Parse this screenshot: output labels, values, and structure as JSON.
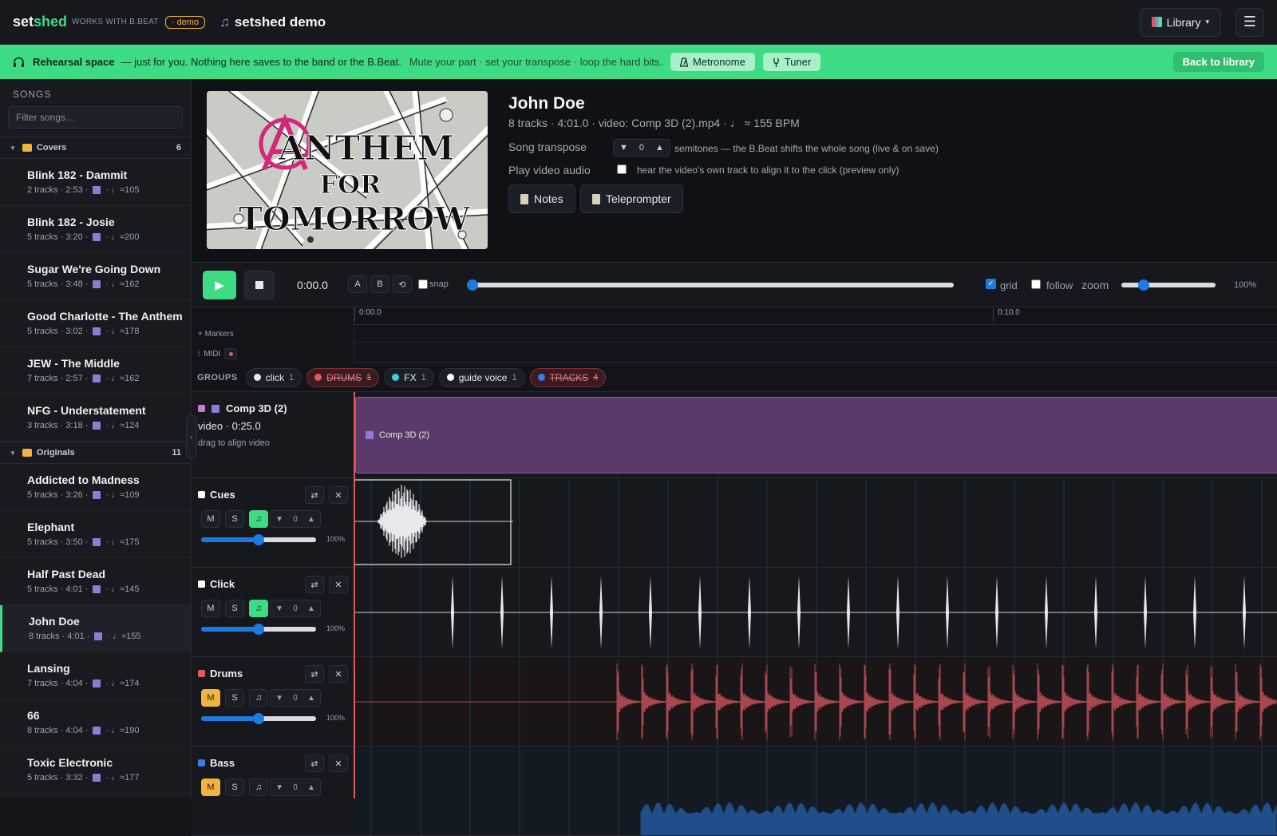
{
  "topbar": {
    "logo_left": "set",
    "logo_right": "shed",
    "tagline": "WORKS WITH B.BEAT",
    "demo_badge": "· demo",
    "app_title": "setshed demo",
    "library_label": "Library",
    "library_caret": "▾",
    "menu_icon": "☰"
  },
  "banner": {
    "title": "Rehearsal space",
    "text": "— just for you. Nothing here saves to the band or the B.Beat.",
    "hint": "Mute your part · set your transpose · loop the hard bits.",
    "metronome_label": "Metronome",
    "tuner_label": "Tuner",
    "back_label": "Back to library",
    "colors": {
      "bg": "#3ddc84"
    }
  },
  "sidebar": {
    "heading": "SONGS",
    "search_placeholder": "Filter songs…",
    "folders": [
      {
        "name": "Covers",
        "count": "6"
      },
      {
        "name": "Originals",
        "count": "11"
      }
    ],
    "covers": [
      {
        "name": "Blink 182 - Dammit",
        "tracks": "2 tracks · 2:53 ·",
        "bpm": "· ♩≈105"
      },
      {
        "name": "Blink 182 - Josie",
        "tracks": "5 tracks · 3:20 ·",
        "bpm": "· ♩≈200"
      },
      {
        "name": "Sugar We're Going Down",
        "tracks": "5 tracks · 3:48 ·",
        "bpm": "· ♩≈162"
      },
      {
        "name": "Good Charlotte - The Anthem",
        "tracks": "5 tracks · 3:02 ·",
        "bpm": "· ♩≈178"
      },
      {
        "name": "JEW - The Middle",
        "tracks": "7 tracks · 2:57 ·",
        "bpm": "· ♩≈162"
      },
      {
        "name": "NFG - Understatement",
        "tracks": "3 tracks · 3:18 ·",
        "bpm": "· ♩≈124"
      }
    ],
    "originals": [
      {
        "name": "Addicted to Madness",
        "tracks": "5 tracks · 3:26 ·",
        "bpm": "· ♩≈109"
      },
      {
        "name": "Elephant",
        "tracks": "5 tracks · 3:50 ·",
        "bpm": "· ♩≈175"
      },
      {
        "name": "Half Past Dead",
        "tracks": "5 tracks · 4:01 ·",
        "bpm": "· ♩≈145"
      },
      {
        "name": "John Doe",
        "tracks": "8 tracks · 4:01 ·",
        "bpm": "· ♩≈155"
      },
      {
        "name": "Lansing",
        "tracks": "7 tracks · 4:04 ·",
        "bpm": "· ♩≈174"
      },
      {
        "name": "66",
        "tracks": "8 tracks · 4:04 ·",
        "bpm": "· ♩≈190"
      },
      {
        "name": "Toxic Electronic",
        "tracks": "5 tracks · 3:32 ·",
        "bpm": "· ♩≈177"
      }
    ],
    "active_song": "John Doe"
  },
  "song": {
    "title": "John Doe",
    "subtitle": "8 tracks · 4:01.0 · video: Comp 3D (2).mp4 · ♩ ≈ 155 BPM",
    "transpose_label": "Song transpose",
    "transpose_value": "0",
    "transpose_hint": "semitones — the B.Beat shifts the whole song (live & on save)",
    "video_audio_label": "Play video audio",
    "video_audio_hint": "hear the video's own track to align it to the click (preview only)",
    "notes_label": "Notes",
    "teleprompter_label": "Teleprompter",
    "cover_line1": "ANTHEM",
    "cover_line2": "FOR",
    "cover_line3": "TOMORROW"
  },
  "transport": {
    "time": "0:00.0",
    "a_label": "A",
    "b_label": "B",
    "snap_label": "snap",
    "grid_label": "grid",
    "follow_label": "follow",
    "zoom_label": "zoom",
    "zoom_value": "100%",
    "position_fraction": 0,
    "zoom_fraction": 0.2
  },
  "ruler": {
    "tick1": "0:00.0",
    "tick2": "0:10.0"
  },
  "lanes": {
    "markers": "+ Markers",
    "midi": "MIDI"
  },
  "groups": {
    "label": "GROUPS",
    "chips": [
      {
        "label": "click",
        "count": "1",
        "color": "#e6e8ec",
        "muted": false
      },
      {
        "label": "DRUMS",
        "count": "1",
        "color": "#e05a5a",
        "muted": true
      },
      {
        "label": "FX",
        "count": "1",
        "color": "#3ad0e0",
        "muted": false
      },
      {
        "label": "guide voice",
        "count": "1",
        "color": "#ffffff",
        "muted": false
      },
      {
        "label": "TRACKS",
        "count": "4",
        "color": "#3a7be0",
        "muted": true
      }
    ]
  },
  "video_track": {
    "name": "Comp 3D (2)",
    "info": "video · 0:25.0",
    "hint": "drag to align video",
    "clip_label": "Comp 3D (2)"
  },
  "tracks": [
    {
      "name": "Cues",
      "color": "#ffffff",
      "mute": "M",
      "solo": "S",
      "transpose": "0",
      "volume": "100%",
      "volume_fraction": 0.5
    },
    {
      "name": "Click",
      "color": "#ffffff",
      "mute": "M",
      "solo": "S",
      "transpose": "0",
      "volume": "100%",
      "volume_fraction": 0.5
    },
    {
      "name": "Drums",
      "color": "#e05a5a",
      "mute": "M",
      "solo": "S",
      "transpose": "0",
      "volume": "100%",
      "volume_fraction": 0.5
    },
    {
      "name": "Bass",
      "color": "#3a7be0",
      "mute": "M",
      "solo": "S",
      "transpose": "0"
    }
  ]
}
